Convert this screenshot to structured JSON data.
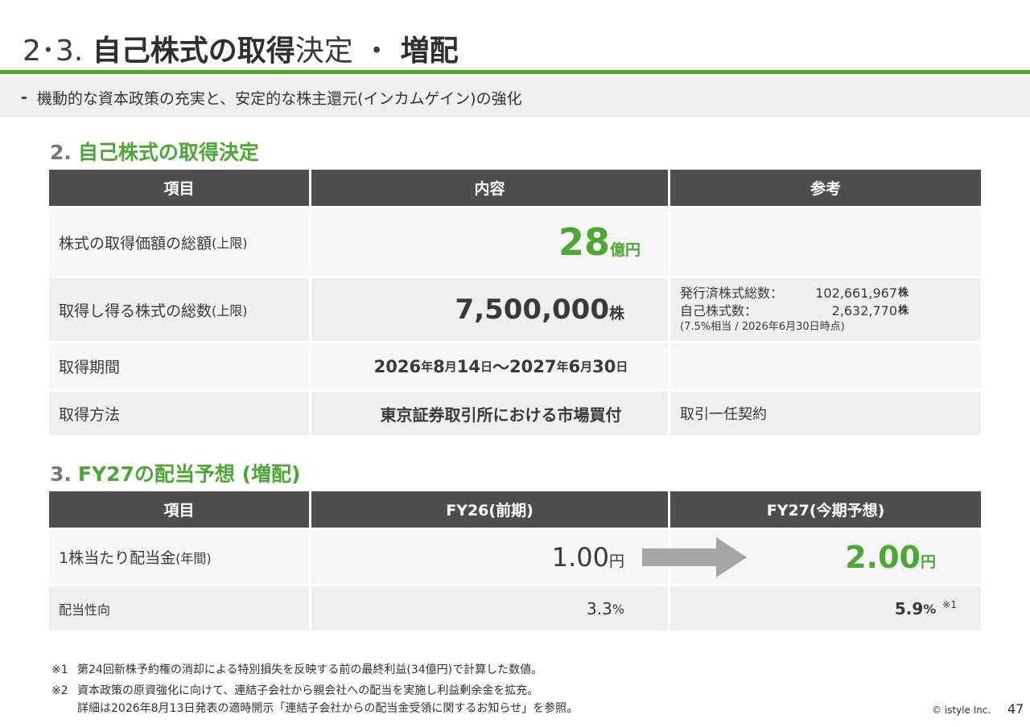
{
  "header": {
    "number": "2･3.",
    "title_bold_1": "自己株式の取得",
    "title_normal": "決定 ・ ",
    "title_bold_2": "増配",
    "subtitle_dash": "-",
    "subtitle": "機動的な資本政策の充実と、安定的な株主還元(インカムゲイン)の強化"
  },
  "section1": {
    "number": "2.",
    "title": "自己株式の取得決定",
    "headers": [
      "項目",
      "内容",
      "参考"
    ],
    "rows": [
      {
        "label": "株式の取得価額の総額",
        "label_note": " (上限)",
        "value": "28",
        "unit": "億円",
        "reference": ""
      },
      {
        "label": "取得し得る株式の総数",
        "label_note": " (上限)",
        "value": "7,500,000",
        "unit": "株",
        "reference_lines": [
          {
            "key": "発行済株式総数：",
            "value": "102,661,967",
            "unit": "株"
          },
          {
            "key": "自己株式数：",
            "value": "2,632,770",
            "unit": "株"
          }
        ],
        "reference_note": "(7.5%相当 / 2026年6月30日時点)"
      },
      {
        "label": "取得期間",
        "value_parts": [
          "2026",
          "年",
          "8",
          "月",
          "14",
          "日",
          "～",
          "2027",
          "年",
          "6",
          "月",
          "30",
          "日"
        ],
        "reference": ""
      },
      {
        "label": "取得方法",
        "value": "東京証券取引所における市場買付",
        "reference": "取引一任契約"
      }
    ]
  },
  "section2": {
    "number": "3.",
    "title": "FY27の配当予想 (増配)",
    "headers": [
      "項目",
      "FY26(前期)",
      "FY27(今期予想)"
    ],
    "rows": [
      {
        "label": "1株当たり配当金",
        "label_note": " (年間)",
        "prev": "1.00",
        "prev_unit": "円",
        "curr": "2.00",
        "curr_unit": "円"
      },
      {
        "label": "配当性向",
        "prev": "3.3",
        "prev_unit": "%",
        "curr": "5.9",
        "curr_unit": "%",
        "curr_note": "※1"
      }
    ]
  },
  "footnotes": [
    {
      "mark": "※1",
      "text": "第24回新株予約権の消却による特別損失を反映する前の最終利益(34億円)で計算した数値。"
    },
    {
      "mark": "※2",
      "text": "資本政策の原資強化に向けて、連結子会社から親会社への配当を実施し利益剰余金を拡充。"
    },
    {
      "mark": "",
      "text": "詳細は2026年8月13日発表の適時開示「連結子会社からの配当金受領に関するお知らせ」を参照。"
    }
  ],
  "footer": {
    "copyright": "© istyle Inc.",
    "page": "47"
  },
  "colors": {
    "accent_green": "#4aa833",
    "header_gray": "#4e4e4e",
    "arrow_gray": "#a6a6a6"
  }
}
